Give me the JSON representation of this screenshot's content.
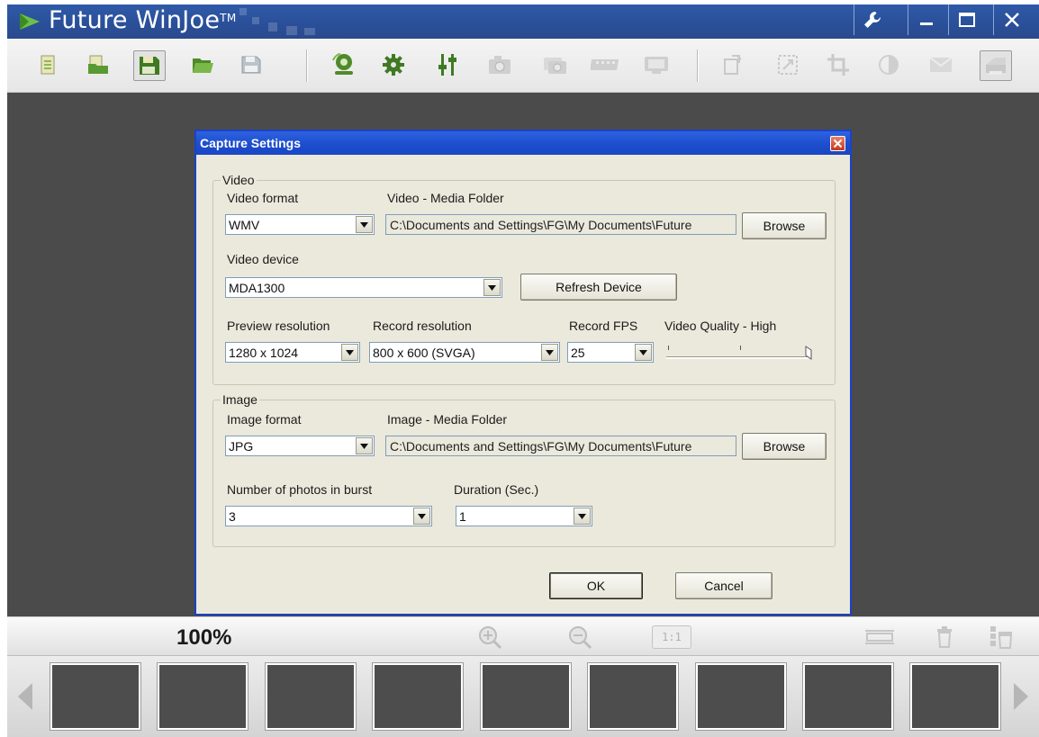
{
  "app": {
    "title": "Future WinJoe",
    "trademark": "TM",
    "window_buttons": [
      "settings-wrench",
      "minimize",
      "maximize",
      "close"
    ]
  },
  "toolbar": {
    "icons": [
      "open-file-icon",
      "open-folder-icon",
      "save-as-icon",
      "open-media-folder-icon",
      "save-icon",
      "webcam-icon",
      "settings-gear-icon",
      "adjust-sliders-icon",
      "camera-icon",
      "burst-camera-icon",
      "video-strip-icon",
      "monitor-icon",
      "rotate-icon",
      "resize-icon",
      "crop-icon",
      "brightness-icon",
      "email-icon",
      "print-icon"
    ]
  },
  "zoom": {
    "percent": "100%",
    "actual_size_label": "1:1"
  },
  "thumbnails": {
    "count": 9
  },
  "dialog": {
    "title": "Capture Settings",
    "video": {
      "group_label": "Video",
      "format_label": "Video format",
      "format_value": "WMV",
      "media_folder_label": "Video - Media Folder",
      "media_folder_value": "C:\\Documents and Settings\\FG\\My Documents\\Future",
      "browse_label": "Browse",
      "device_label": "Video device",
      "device_value": "MDA1300",
      "refresh_label": "Refresh Device",
      "preview_res_label": "Preview resolution",
      "preview_res_value": "1280 x 1024",
      "record_res_label": "Record resolution",
      "record_res_value": "800 x 600 (SVGA)",
      "fps_label": "Record FPS",
      "fps_value": "25",
      "quality_label": "Video Quality - High",
      "quality_level": 1.0
    },
    "image": {
      "group_label": "Image",
      "format_label": "Image format",
      "format_value": "JPG",
      "media_folder_label": "Image - Media Folder",
      "media_folder_value": "C:\\Documents and Settings\\FG\\My Documents\\Future",
      "browse_label": "Browse",
      "burst_label": "Number of photos in burst",
      "burst_value": "3",
      "duration_label": "Duration (Sec.)",
      "duration_value": "1"
    },
    "ok_label": "OK",
    "cancel_label": "Cancel"
  },
  "colors": {
    "titlebar": "#2a4f98",
    "canvas": "#4b4b4b",
    "dialog_bg": "#ebe9dc",
    "dialog_title": "#1d4fcf",
    "icon_green": "#4f8a2a"
  }
}
